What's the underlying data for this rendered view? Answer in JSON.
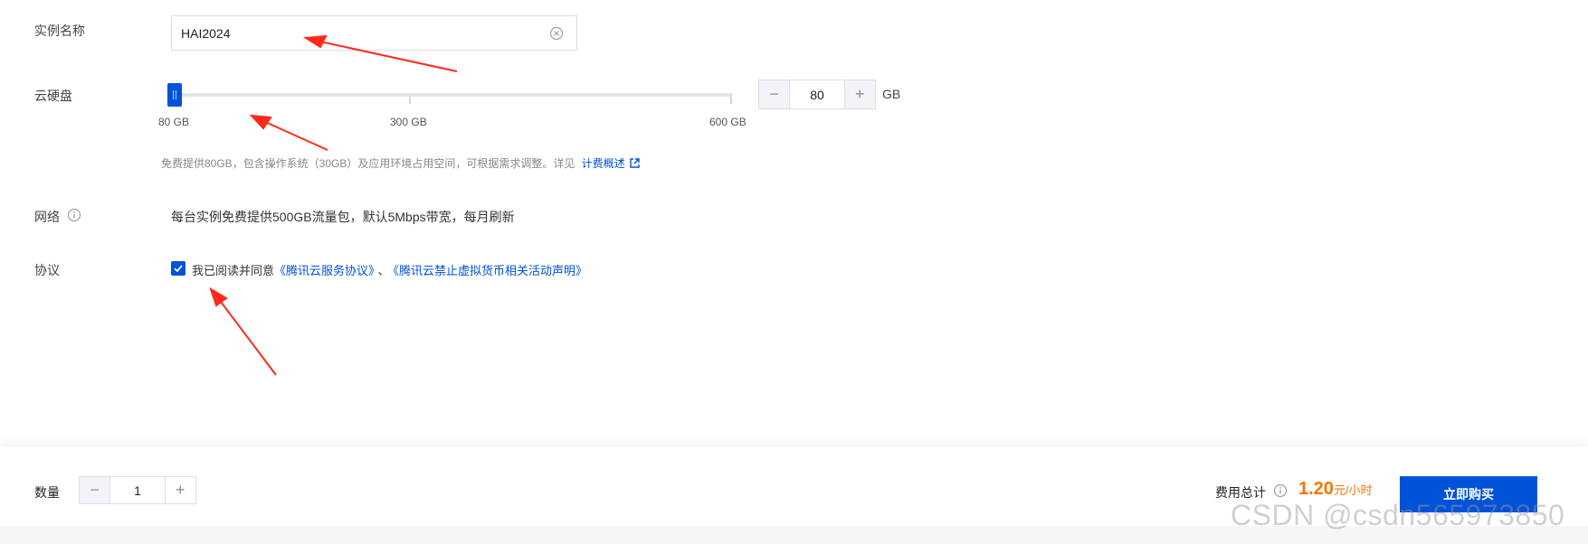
{
  "form": {
    "instance_name_label": "实例名称",
    "instance_name_value": "HAI2024",
    "disk_label": "云硬盘",
    "disk_ticks": [
      "80 GB",
      "300 GB",
      "600 GB"
    ],
    "disk_value": "80",
    "disk_unit": "GB",
    "disk_slider_fraction": 0.0,
    "disk_hint": "免费提供80GB，包含操作系统（30GB）及应用环境占用空间，可根据需求调整。详见",
    "disk_hint_link": "计费概述",
    "network_label": "网络",
    "network_desc": "每台实例免费提供500GB流量包，默认5Mbps带宽，每月刷新",
    "agreement_label": "协议",
    "agreement_prefix": "我已阅读并同意",
    "agreement_link1": "《腾讯云服务协议》",
    "agreement_sep": "、",
    "agreement_link2": "《腾讯云禁止虚拟货币相关活动声明》",
    "agreement_checked": true
  },
  "stepper_symbols": {
    "minus": "−",
    "plus": "+"
  },
  "bottom": {
    "quantity_label": "数量",
    "quantity_value": "1",
    "total_label": "费用总计",
    "price": "1.20",
    "price_unit": "元/小时",
    "buy_label": "立即购买"
  },
  "watermark": "CSDN @csdn565973850",
  "colors": {
    "accent": "#0052d9",
    "price": "#ff7200",
    "annotation": "#ff2a1a"
  },
  "icons": [
    "clear-icon",
    "info-icon",
    "external-link-icon",
    "check-icon",
    "annotation-arrow"
  ]
}
